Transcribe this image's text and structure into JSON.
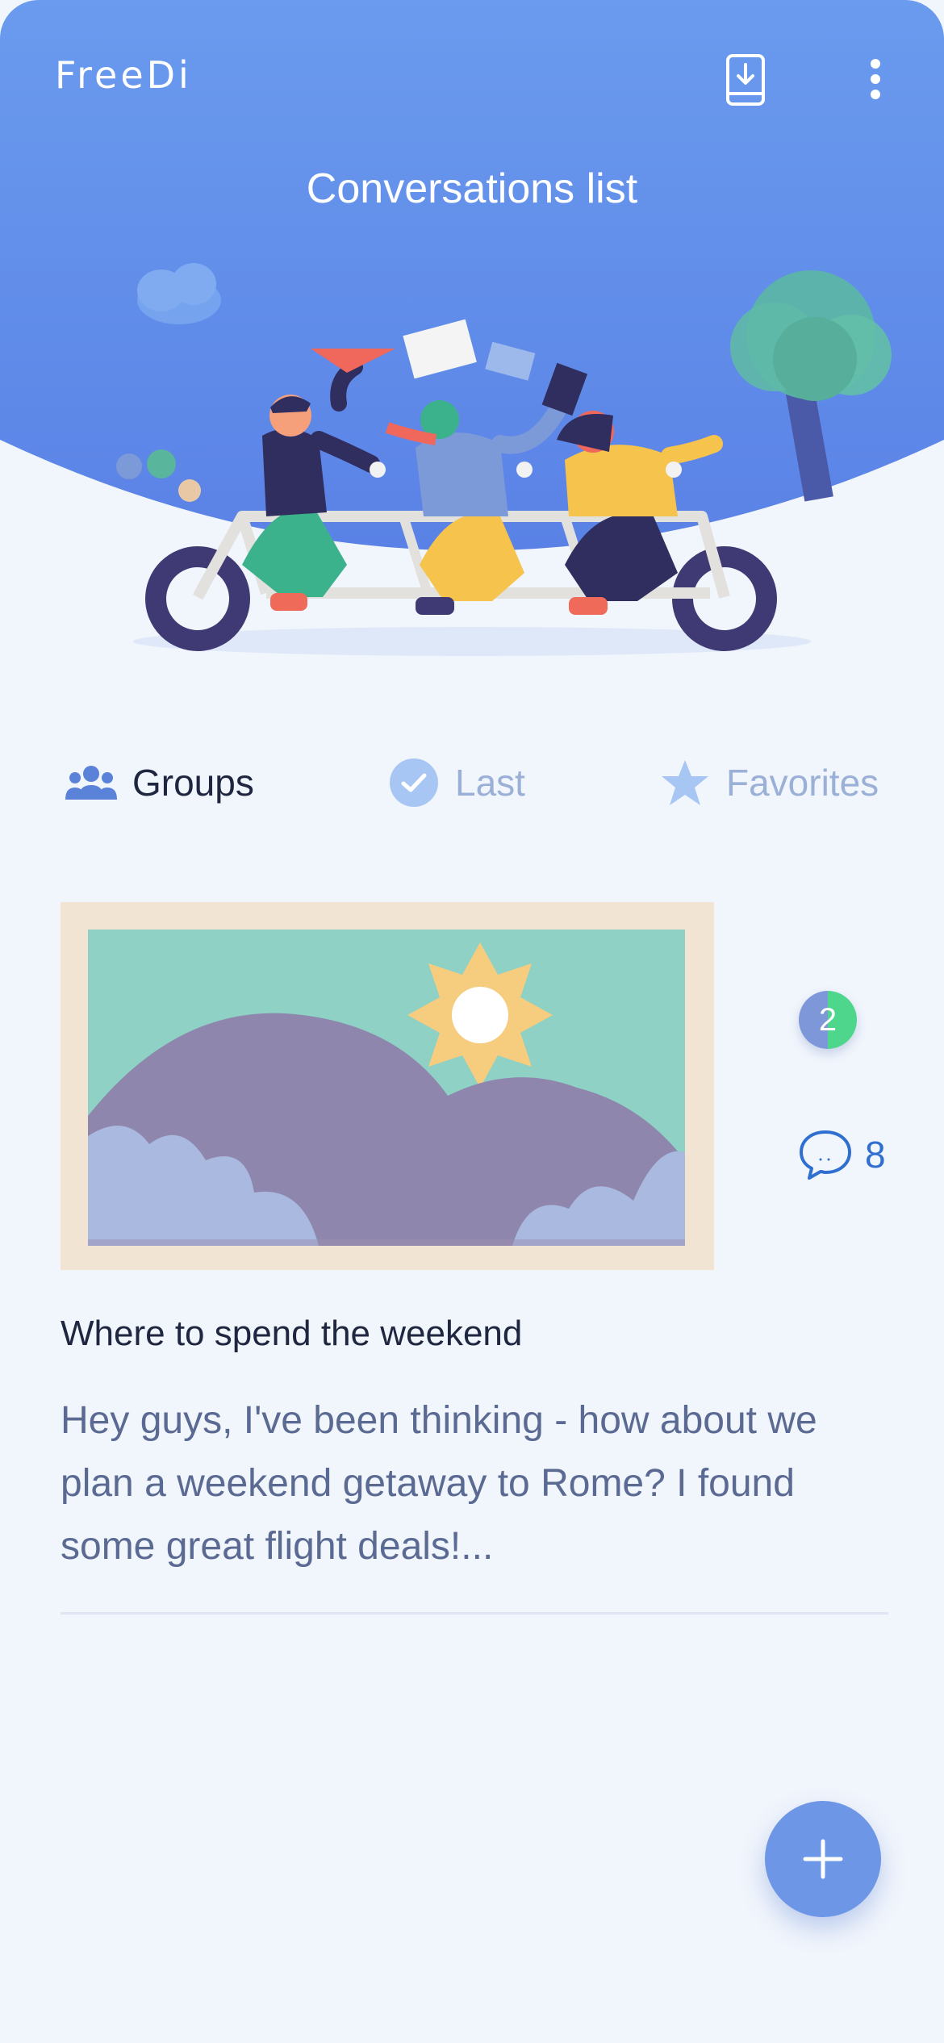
{
  "app": {
    "logo": "FreeDi",
    "title": "Conversations list",
    "icons": {
      "download": "download-phone-icon",
      "menu": "more-vertical-icon"
    }
  },
  "colors": {
    "header_blue": "#6a9bee",
    "background": "#f1f5fc",
    "accent": "#6d97e6",
    "active_text": "#1f2640",
    "inactive_text": "#9bb0d6",
    "badge_green": "#4fd68d"
  },
  "tabs": [
    {
      "label": "Groups",
      "icon": "groups-icon",
      "active": true
    },
    {
      "label": "Last",
      "icon": "clock-check-icon",
      "active": false
    },
    {
      "label": "Favorites",
      "icon": "star-icon",
      "active": false
    }
  ],
  "conversations": [
    {
      "title": "Where to spend the weekend",
      "preview": "Hey guys, I've been thinking - how about we plan a weekend getaway to Rome? I found some great flight deals!...",
      "unread": "2",
      "comments": "8",
      "thumbnail": "landscape-mountain-sun-image"
    }
  ],
  "fab": {
    "icon": "plus-icon"
  }
}
